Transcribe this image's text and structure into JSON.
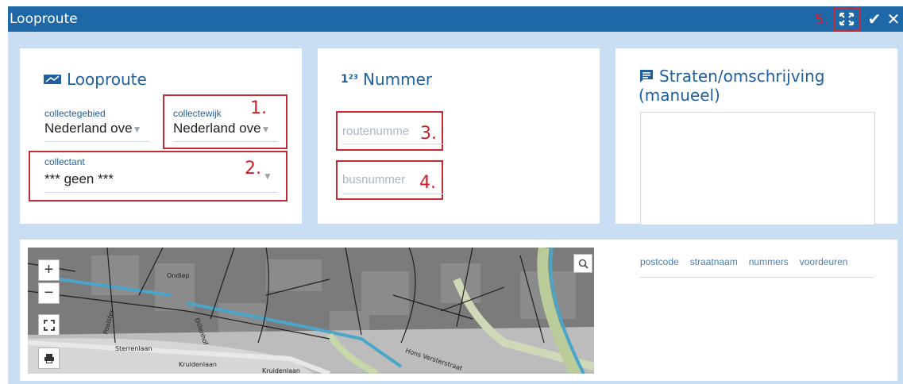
{
  "window": {
    "title": "Looproute"
  },
  "annotations": {
    "a1": "1.",
    "a2": "2.",
    "a3": "3.",
    "a4": "4.",
    "a5": "5."
  },
  "cards": {
    "looproute": {
      "title": "Looproute",
      "collectegebied": {
        "label": "collectegebied",
        "value": "Nederland ove"
      },
      "collectewijk": {
        "label": "collectewijk",
        "value": "Nederland ove"
      },
      "collectant": {
        "label": "collectant",
        "value": "*** geen ***"
      }
    },
    "nummer": {
      "title": "Nummer",
      "routenummer_placeholder": "routenumme",
      "busnummer_placeholder": "busnummer"
    },
    "straten": {
      "title_line1": "Straten/omschrijving",
      "title_line2": "(manueel)"
    }
  },
  "map": {
    "zoom_in": "+",
    "zoom_out": "−",
    "street_labels": [
      "Sterrenlaan",
      "Kruidenlaan",
      "Kruidenlaan",
      "Hons Versterstraat",
      "Poolster",
      "Dillenhof",
      "Ondiep"
    ]
  },
  "table": {
    "columns": [
      "postcode",
      "straatnaam",
      "nummers",
      "voordeuren"
    ]
  },
  "colors": {
    "header": "#1f68a8",
    "annotation": "#c22a35",
    "panel_bg": "#c9def2",
    "accent": "#1f5f9e"
  }
}
